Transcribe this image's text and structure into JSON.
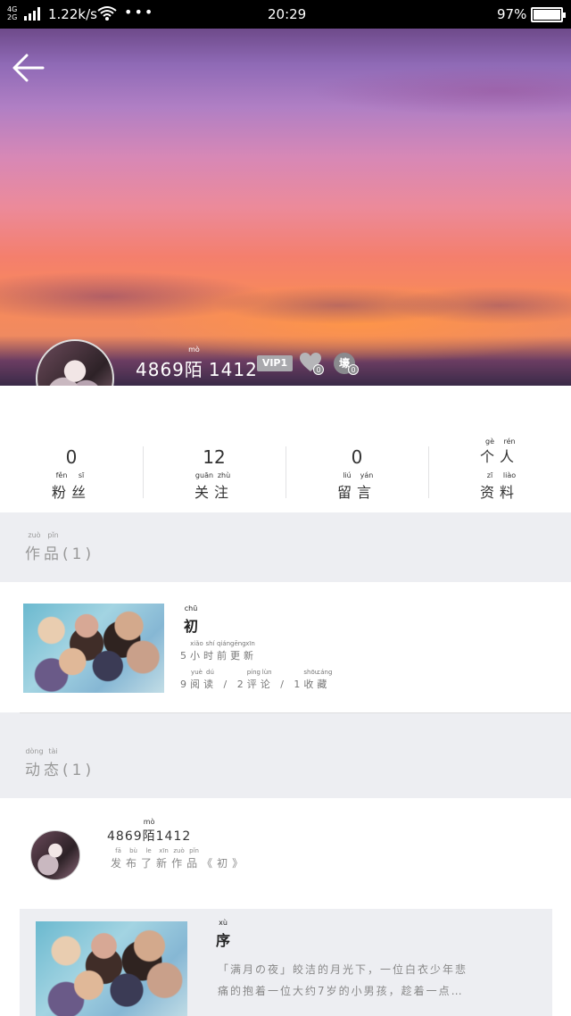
{
  "status_bar": {
    "network": "4G\n2G",
    "speed": "1.22k/s",
    "more": "•••",
    "time": "20:29",
    "battery": "97%"
  },
  "profile": {
    "name_prefix": "4869",
    "name_mid": "陌",
    "name_mid_pinyin": "mò",
    "name_suffix": "1412",
    "vip": "VIP1",
    "heart_count": "0",
    "hao_label": "壕",
    "hao_count": "0"
  },
  "stats": [
    {
      "num": "0",
      "label": [
        "粉",
        "丝"
      ],
      "pinyin": [
        "fěn",
        "sī"
      ]
    },
    {
      "num": "12",
      "label": [
        "关",
        "注"
      ],
      "pinyin": [
        "guān",
        "zhù"
      ]
    },
    {
      "num": "0",
      "label": [
        "留",
        "言"
      ],
      "pinyin": [
        "liú",
        "yán"
      ]
    },
    {
      "num": "",
      "top": [
        "个",
        "人"
      ],
      "top_pinyin": [
        "gè",
        "rén"
      ],
      "label": [
        "资",
        "料"
      ],
      "pinyin": [
        "zī",
        "liào"
      ]
    }
  ],
  "works_section": {
    "title": [
      "作",
      "品"
    ],
    "pinyin": [
      "zuò",
      "pǐn"
    ],
    "count": "(1)"
  },
  "work": {
    "title": "初",
    "title_pinyin": "chū",
    "updated": [
      "5",
      "小",
      "时",
      "前",
      "更",
      "新"
    ],
    "updated_pinyin": [
      "",
      "xiǎo",
      "shí",
      "qián",
      "gēng",
      "xīn"
    ],
    "stats": [
      "9",
      "阅",
      "读",
      " / 2",
      "评",
      "论",
      " / 1",
      "收",
      "藏"
    ],
    "stats_pinyin": [
      "",
      "yuè",
      "dú",
      "",
      "píng",
      "lùn",
      "",
      "shōu",
      "cáng"
    ]
  },
  "activity_section": {
    "title": [
      "动",
      "态"
    ],
    "pinyin": [
      "dòng",
      "tài"
    ],
    "count": "(1)"
  },
  "activity": {
    "name": "4869陌1412",
    "desc": [
      "发",
      "布",
      "了",
      "新",
      "作",
      "品",
      "《初》"
    ],
    "desc_pinyin": [
      "fā",
      "bù",
      "le",
      "xīn",
      "zuò",
      "pǐn",
      ""
    ],
    "quote_title": "序",
    "quote_title_pinyin": "xù",
    "quote_line1": "「满月の夜」皎洁的月光下，一位白衣少年悲",
    "quote_line2": "痛的抱着一位大约7岁的小男孩，趁着一点…"
  }
}
